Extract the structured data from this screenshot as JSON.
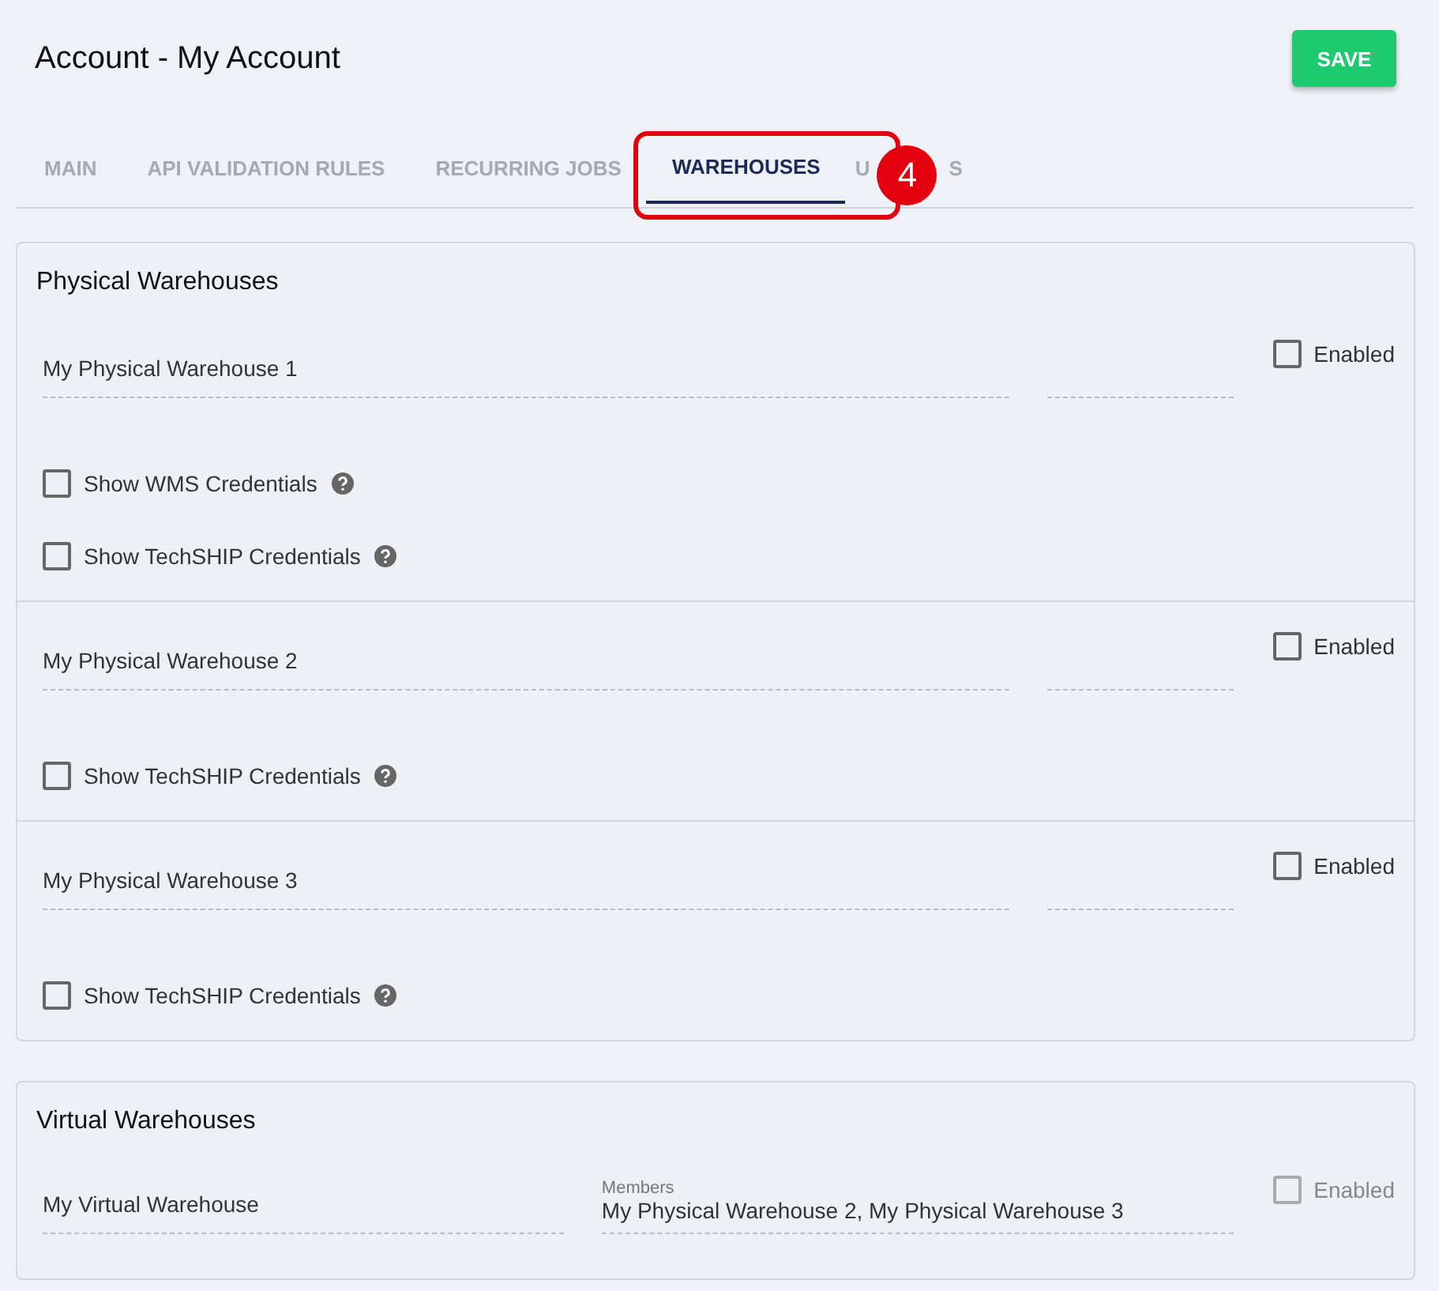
{
  "header": {
    "title": "Account - My Account",
    "save_button": "SAVE"
  },
  "tabs": [
    {
      "label_parts": [
        "MAIN"
      ],
      "selected": false
    },
    {
      "label_parts": [
        "API VALIDATION RULES"
      ],
      "selected": false
    },
    {
      "label_parts": [
        "RECURRING JOBS"
      ],
      "selected": false
    },
    {
      "label_parts": [
        "WAREHOUSES"
      ],
      "selected": true,
      "callout_badge": "4"
    },
    {
      "label_parts": [
        "U",
        "S"
      ],
      "selected": false
    }
  ],
  "physical_warehouses": {
    "title": "Physical Warehouses",
    "warehouses": [
      {
        "name": "My Physical Warehouse 1",
        "enabled_label": "Enabled",
        "enabled": false,
        "options": [
          {
            "label": "Show WMS Credentials",
            "checked": false
          },
          {
            "label": "Show TechSHIP Credentials",
            "checked": false
          }
        ]
      },
      {
        "name": "My Physical Warehouse 2",
        "enabled_label": "Enabled",
        "enabled": false,
        "options": [
          {
            "label": "Show TechSHIP Credentials",
            "checked": false
          }
        ]
      },
      {
        "name": "My Physical Warehouse 3",
        "enabled_label": "Enabled",
        "enabled": false,
        "options": [
          {
            "label": "Show TechSHIP Credentials",
            "checked": false
          }
        ]
      }
    ]
  },
  "virtual_warehouses": {
    "title": "Virtual Warehouses",
    "warehouses": [
      {
        "name": "My Virtual Warehouse",
        "members_label": "Members",
        "members": "My Physical Warehouse 2, My Physical Warehouse 3",
        "enabled_label": "Enabled",
        "enabled": false,
        "disabled": true
      }
    ]
  }
}
